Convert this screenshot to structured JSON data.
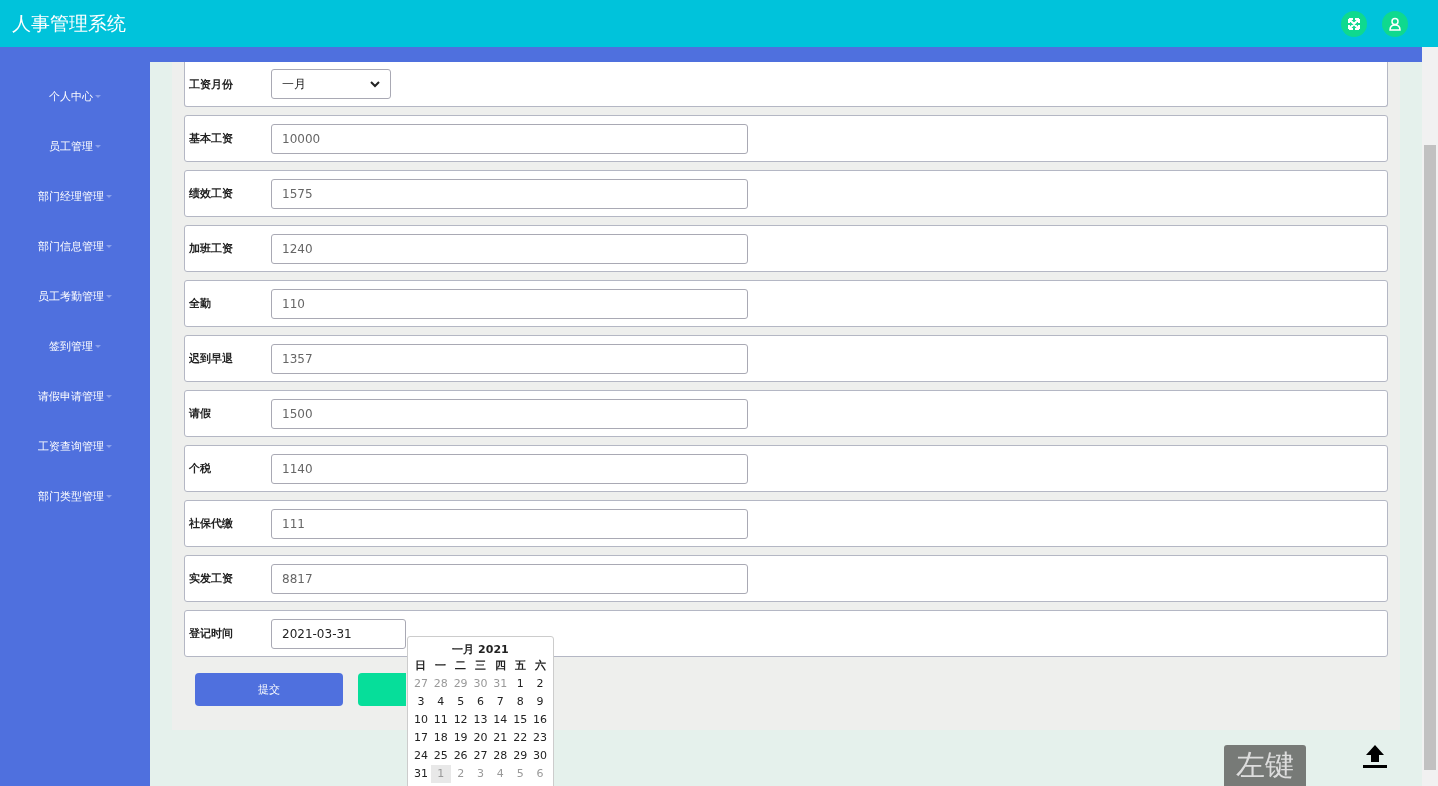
{
  "header": {
    "title": "人事管理系统"
  },
  "sidebar": {
    "items": [
      {
        "label": "个人中心"
      },
      {
        "label": "员工管理"
      },
      {
        "label": "部门经理管理"
      },
      {
        "label": "部门信息管理"
      },
      {
        "label": "员工考勤管理"
      },
      {
        "label": "签到管理"
      },
      {
        "label": "请假申请管理"
      },
      {
        "label": "工资查询管理"
      },
      {
        "label": "部门类型管理"
      }
    ]
  },
  "form": {
    "rows": [
      {
        "kind": "select",
        "label": "工资月份",
        "value": "一月"
      },
      {
        "kind": "text",
        "label": "基本工资",
        "value": "10000"
      },
      {
        "kind": "text",
        "label": "绩效工资",
        "value": "1575"
      },
      {
        "kind": "text",
        "label": "加班工资",
        "value": "1240"
      },
      {
        "kind": "text",
        "label": "全勤",
        "value": "110"
      },
      {
        "kind": "text",
        "label": "迟到早退",
        "value": "1357"
      },
      {
        "kind": "text",
        "label": "请假",
        "value": "1500"
      },
      {
        "kind": "text",
        "label": "个税",
        "value": "1140"
      },
      {
        "kind": "text",
        "label": "社保代缴",
        "value": "111"
      },
      {
        "kind": "text",
        "label": "实发工资",
        "value": "8817"
      },
      {
        "kind": "date",
        "label": "登记时间",
        "value": "2021-03-31"
      }
    ],
    "buttons": [
      {
        "kind": "primary",
        "label": "提交"
      },
      {
        "kind": "secondary"
      }
    ]
  },
  "calendar": {
    "title": "一月 2021",
    "weekdays": [
      "日",
      "一",
      "二",
      "三",
      "四",
      "五",
      "六"
    ],
    "days": [
      {
        "label": "27",
        "muted": true,
        "hovered": false
      },
      {
        "label": "28",
        "muted": true,
        "hovered": false
      },
      {
        "label": "29",
        "muted": true,
        "hovered": false
      },
      {
        "label": "30",
        "muted": true,
        "hovered": false
      },
      {
        "label": "31",
        "muted": true,
        "hovered": false
      },
      {
        "label": "1",
        "muted": false,
        "hovered": false
      },
      {
        "label": "2",
        "muted": false,
        "hovered": false
      },
      {
        "label": "3",
        "muted": false,
        "hovered": false
      },
      {
        "label": "4",
        "muted": false,
        "hovered": false
      },
      {
        "label": "5",
        "muted": false,
        "hovered": false
      },
      {
        "label": "6",
        "muted": false,
        "hovered": false
      },
      {
        "label": "7",
        "muted": false,
        "hovered": false
      },
      {
        "label": "8",
        "muted": false,
        "hovered": false
      },
      {
        "label": "9",
        "muted": false,
        "hovered": false
      },
      {
        "label": "10",
        "muted": false,
        "hovered": false
      },
      {
        "label": "11",
        "muted": false,
        "hovered": false
      },
      {
        "label": "12",
        "muted": false,
        "hovered": false
      },
      {
        "label": "13",
        "muted": false,
        "hovered": false
      },
      {
        "label": "14",
        "muted": false,
        "hovered": false
      },
      {
        "label": "15",
        "muted": false,
        "hovered": false
      },
      {
        "label": "16",
        "muted": false,
        "hovered": false
      },
      {
        "label": "17",
        "muted": false,
        "hovered": false
      },
      {
        "label": "18",
        "muted": false,
        "hovered": false
      },
      {
        "label": "19",
        "muted": false,
        "hovered": false
      },
      {
        "label": "20",
        "muted": false,
        "hovered": false
      },
      {
        "label": "21",
        "muted": false,
        "hovered": false
      },
      {
        "label": "22",
        "muted": false,
        "hovered": false
      },
      {
        "label": "23",
        "muted": false,
        "hovered": false
      },
      {
        "label": "24",
        "muted": false,
        "hovered": false
      },
      {
        "label": "25",
        "muted": false,
        "hovered": false
      },
      {
        "label": "26",
        "muted": false,
        "hovered": false
      },
      {
        "label": "27",
        "muted": false,
        "hovered": false
      },
      {
        "label": "28",
        "muted": false,
        "hovered": false
      },
      {
        "label": "29",
        "muted": false,
        "hovered": false
      },
      {
        "label": "30",
        "muted": false,
        "hovered": false
      },
      {
        "label": "31",
        "muted": false,
        "hovered": false
      },
      {
        "label": "1",
        "muted": true,
        "hovered": true
      },
      {
        "label": "2",
        "muted": true,
        "hovered": false
      },
      {
        "label": "3",
        "muted": true,
        "hovered": false
      },
      {
        "label": "4",
        "muted": true,
        "hovered": false
      },
      {
        "label": "5",
        "muted": true,
        "hovered": false
      },
      {
        "label": "6",
        "muted": true,
        "hovered": false
      }
    ]
  },
  "key_overlay": {
    "text": "左键"
  }
}
